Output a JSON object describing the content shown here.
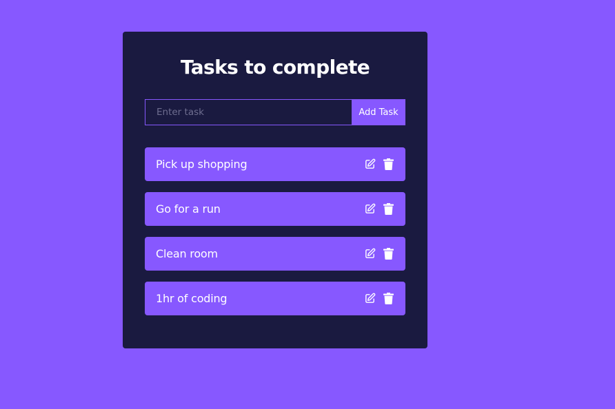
{
  "header": {
    "title": "Tasks to complete"
  },
  "form": {
    "placeholder": "Enter task",
    "value": "",
    "add_label": "Add Task"
  },
  "tasks": [
    {
      "text": "Pick up shopping"
    },
    {
      "text": "Go for a run"
    },
    {
      "text": "Clean room"
    },
    {
      "text": "1hr of coding"
    }
  ],
  "icons": {
    "edit": "edit-icon",
    "delete": "trash-icon"
  },
  "colors": {
    "background": "#8758ff",
    "card": "#1a1a40",
    "accent": "#8758ff",
    "text": "#ffffff"
  }
}
